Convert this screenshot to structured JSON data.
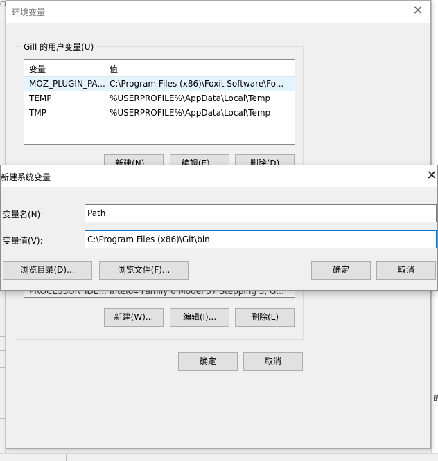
{
  "background": {
    "top_left_glyph": "○",
    "right_edge_glyph": "的"
  },
  "env_dialog": {
    "title": "环境变量",
    "close_glyph": "✕",
    "user_group_label": "Gill 的用户变量(U)",
    "list": {
      "col_variable": "变量",
      "col_value": "值",
      "rows": [
        {
          "name": "MOZ_PLUGIN_PA...",
          "value": "C:\\Program Files (x86)\\Foxit Software\\Fo..."
        },
        {
          "name": "TEMP",
          "value": "%USERPROFILE%\\AppData\\Local\\Temp"
        },
        {
          "name": "TMP",
          "value": "%USERPROFILE%\\AppData\\Local\\Temp"
        }
      ]
    },
    "user_buttons": {
      "new": "新建(N)...",
      "edit": "编辑(E)...",
      "delete": "删除(D)"
    },
    "system_partial_row": {
      "name": "PROCESSOR_IDE...",
      "value": "Intel64 Family 6 Model 37 Stepping 5, G..."
    },
    "system_buttons": {
      "new": "新建(W)...",
      "edit": "编辑(I)...",
      "delete": "删除(L)"
    },
    "ok": "确定",
    "cancel": "取消"
  },
  "new_var_dialog": {
    "title": "新建系统变量",
    "close_glyph": "✕",
    "name_label": "变量名(N):",
    "name_value": "Path",
    "value_label": "变量值(V):",
    "value_value": "C:\\Program Files (x86)\\Git\\bin",
    "browse_dir": "浏览目录(D)...",
    "browse_file": "浏览文件(F)...",
    "ok": "确定",
    "cancel": "取消"
  }
}
